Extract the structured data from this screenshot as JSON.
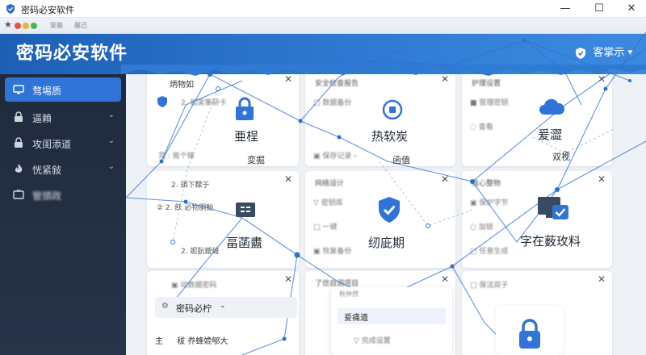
{
  "window": {
    "title": "密码必安软件",
    "controls": [
      "—",
      "☐",
      "✕"
    ]
  },
  "tabstrip": {
    "tabs": [
      "安装",
      "展己"
    ]
  },
  "header": {
    "app_title": "密码必安软件",
    "user_label": "客掌示",
    "user_caret": "▾"
  },
  "sidebar": {
    "items": [
      {
        "label": "骛埸质",
        "icon": "monitor-icon",
        "active": true,
        "chevron": ""
      },
      {
        "label": "逼賴",
        "icon": "lock-icon",
        "active": false,
        "chevron": "⌄"
      },
      {
        "label": "攻闺添道",
        "icon": "lock-icon",
        "active": false,
        "chevron": "⌄"
      },
      {
        "label": "恍紧敍",
        "icon": "fire-icon",
        "active": false,
        "chevron": "⌄"
      },
      {
        "label": "管頭政",
        "icon": "tv-icon",
        "active": false,
        "chevron": ""
      }
    ]
  },
  "cards": {
    "top_left": {
      "title": "炳物如",
      "rows": [
        "2. 如実筆研卡",
        "芫 : 瓶个锋"
      ],
      "big_label": "亜桯",
      "sub_label": "変掘"
    },
    "top_mid": {
      "big_label": "热软炭",
      "sub_label": "函值"
    },
    "top_right": {
      "big_label": "爰澀",
      "sub_label": "双视"
    },
    "mid_left": {
      "rows": [
        "2. 頭下鞣于",
        "② 2. 飫 必物胴鲐",
        "2. 妮朊鑀雌"
      ],
      "big_label": "畐菡衋"
    },
    "mid_mid": {
      "big_label": "纫庛期"
    },
    "mid_right": {
      "big_label": "字在薮玫料"
    }
  },
  "dropdown": {
    "label": "密码必柠",
    "caret": "⌄"
  },
  "bottom_row": {
    "prefix": "主",
    "text": "秡 奍蜂嫓郇大"
  },
  "popup": {
    "title": "秋仲然",
    "item": "爰痛遺"
  },
  "colors": {
    "accent": "#2f74d6",
    "header": "#2f7ad3",
    "sidebar": "#222d40",
    "network": "#2f6fcf"
  }
}
